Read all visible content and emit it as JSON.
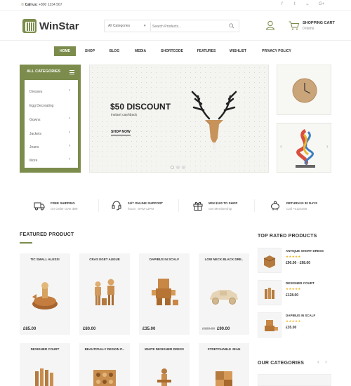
{
  "topbar": {
    "call_label": "Call us:",
    "phone": "+800 1234 567",
    "social": [
      "f",
      "t",
      "rss",
      "G+"
    ]
  },
  "header": {
    "brand": "WinStar",
    "search_category": "All Categories",
    "search_placeholder": "Search Products...",
    "cart_title": "SHOPPING CART",
    "cart_items": "0 Items"
  },
  "nav": {
    "items": [
      "HOME",
      "SHOP",
      "BLOG",
      "MEDIA",
      "SHORTCODE",
      "FEATURES",
      "WISHLIST",
      "PRIVACY POLICY"
    ]
  },
  "categories": {
    "title": "ALL CATEGORIES",
    "items": [
      "Dresses",
      "Egg Decorating",
      "Gowns",
      "Jackets",
      "Jeans",
      "More"
    ]
  },
  "banner": {
    "title": "$50 DISCOUNT",
    "subtitle": "instant cashback",
    "button": "SHOP NOW"
  },
  "services": [
    {
      "title": "FREE SHIPPING",
      "sub": "On Order Over $99",
      "icon": "truck-icon"
    },
    {
      "title": "24/7 ONLINE SUPPORT",
      "sub": "hours : 8AM-11PM",
      "icon": "headset-icon"
    },
    {
      "title": "WIN $100 TO SHOP",
      "sub": "Get Membership",
      "icon": "gift-icon"
    },
    {
      "title": "RETURN IN 30 DAYS",
      "sub": "Call +0123456",
      "icon": "piggy-bank-icon"
    }
  ],
  "featured": {
    "title": "FEATURED PRODUCT",
    "row1": [
      {
        "name": "TIC SMALL ALESSI",
        "price": "£85.00"
      },
      {
        "name": "CRAS EGET AUGUE",
        "price": "£80.00"
      },
      {
        "name": "DAPIBUS IN SCALF",
        "price": "£35.00"
      },
      {
        "name": "LOW NECK BLACK DRE..",
        "old": "£102.00",
        "price": "£90.00"
      }
    ],
    "row2": [
      {
        "name": "DESIGNER COURT"
      },
      {
        "name": "BEAUTIFULLY DESIGN P..."
      },
      {
        "name": "WHITE DESIGNER DRESS"
      },
      {
        "name": "STRETCHABLE JEAN"
      }
    ]
  },
  "top_rated": {
    "title": "TOP RATED PRODUCTS",
    "items": [
      {
        "name": "ANTIQUE SHORT DRESS",
        "stars": "★★★★★",
        "price": "£90.00 - £98.00"
      },
      {
        "name": "DESIGNER COURT",
        "stars": "★★★★★",
        "price": "£128.00"
      },
      {
        "name": "DAPIBUS IN SCALF",
        "stars": "★★★★★",
        "price": "£35.00"
      }
    ]
  },
  "our_categories": {
    "title": "OUR CATEGORIES",
    "prev": "‹",
    "next": "›"
  },
  "colors": {
    "accent": "#7c8c4c",
    "star": "#f2b01e"
  }
}
